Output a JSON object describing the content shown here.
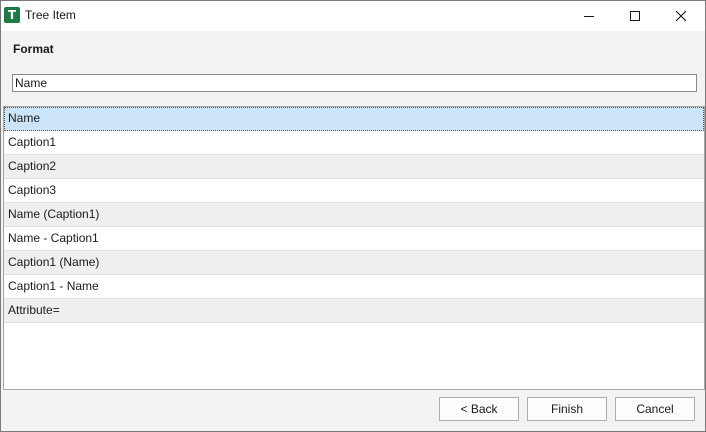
{
  "window": {
    "title": "Tree Item",
    "icon_letter": "T",
    "icon_color": "#1e7a44"
  },
  "format": {
    "label": "Format",
    "value": "Name"
  },
  "list": {
    "selected_index": 0,
    "selection_color": "#cce4f7",
    "items": [
      "Name",
      "Caption1",
      "Caption2",
      "Caption3",
      "Name (Caption1)",
      "Name - Caption1",
      "Caption1 (Name)",
      "Caption1 - Name",
      "Attribute="
    ]
  },
  "buttons": {
    "back": "< Back",
    "finish": "Finish",
    "cancel": "Cancel"
  }
}
